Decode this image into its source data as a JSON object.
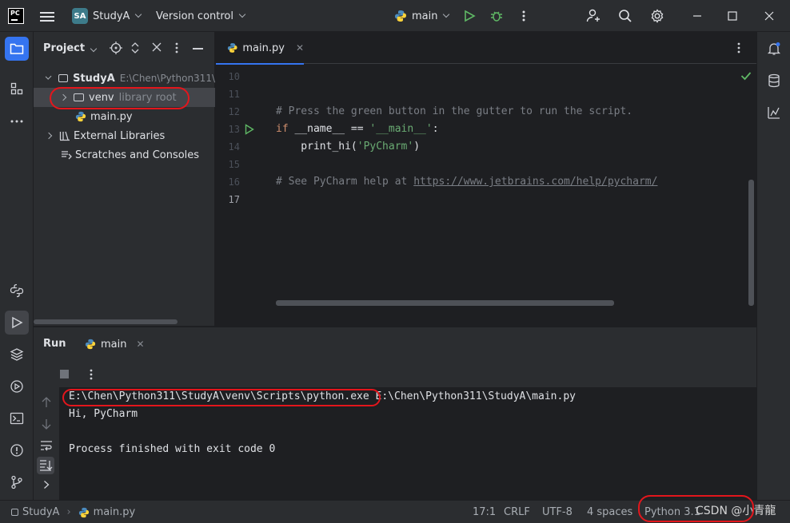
{
  "titlebar": {
    "logo_text": "PC",
    "project_badge": "SA",
    "project_name": "StudyA",
    "vcs_label": "Version control",
    "run_config": "main"
  },
  "project_panel": {
    "title": "Project",
    "tree": [
      {
        "label": "StudyA",
        "hint": "E:\\Chen\\Python311\\"
      },
      {
        "label": "venv",
        "hint": "library root"
      },
      {
        "label": "main.py"
      },
      {
        "label": "External Libraries"
      },
      {
        "label": "Scratches and Consoles"
      }
    ]
  },
  "editor": {
    "tab_label": "main.py",
    "line_numbers": [
      "10",
      "11",
      "12",
      "13",
      "14",
      "15",
      "16",
      "17"
    ],
    "code": {
      "l12": "# Press the green button in the gutter to run the script.",
      "l13_kw": "if",
      "l13_mid": " __name__ == ",
      "l13_str": "'__main__'",
      "l13_end": ":",
      "l14_fn": "    print_hi(",
      "l14_str": "'PyCharm'",
      "l14_end": ")",
      "l16_a": "# See PyCharm help at ",
      "l16_link": "https://www.jetbrains.com/help/pycharm/"
    }
  },
  "run_panel": {
    "title": "Run",
    "tab_label": "main",
    "console": {
      "line1_a": "E:\\Chen\\Python311\\StudyA\\venv\\Scripts\\python.exe",
      "line1_b": " E:\\Chen\\Python311\\StudyA\\main.py",
      "line2": "Hi, PyCharm",
      "line4": "Process finished with exit code 0"
    }
  },
  "statusbar": {
    "breadcrumb_project": "StudyA",
    "breadcrumb_file": "main.py",
    "position": "17:1",
    "line_sep": "CRLF",
    "encoding": "UTF-8",
    "indent": "4 spaces",
    "interpreter": "Python 3.1",
    "watermark": "CSDN @小青龍"
  },
  "colors": {
    "accent": "#3574f0",
    "annotation": "#e3161c",
    "run_green": "#5fb865"
  }
}
